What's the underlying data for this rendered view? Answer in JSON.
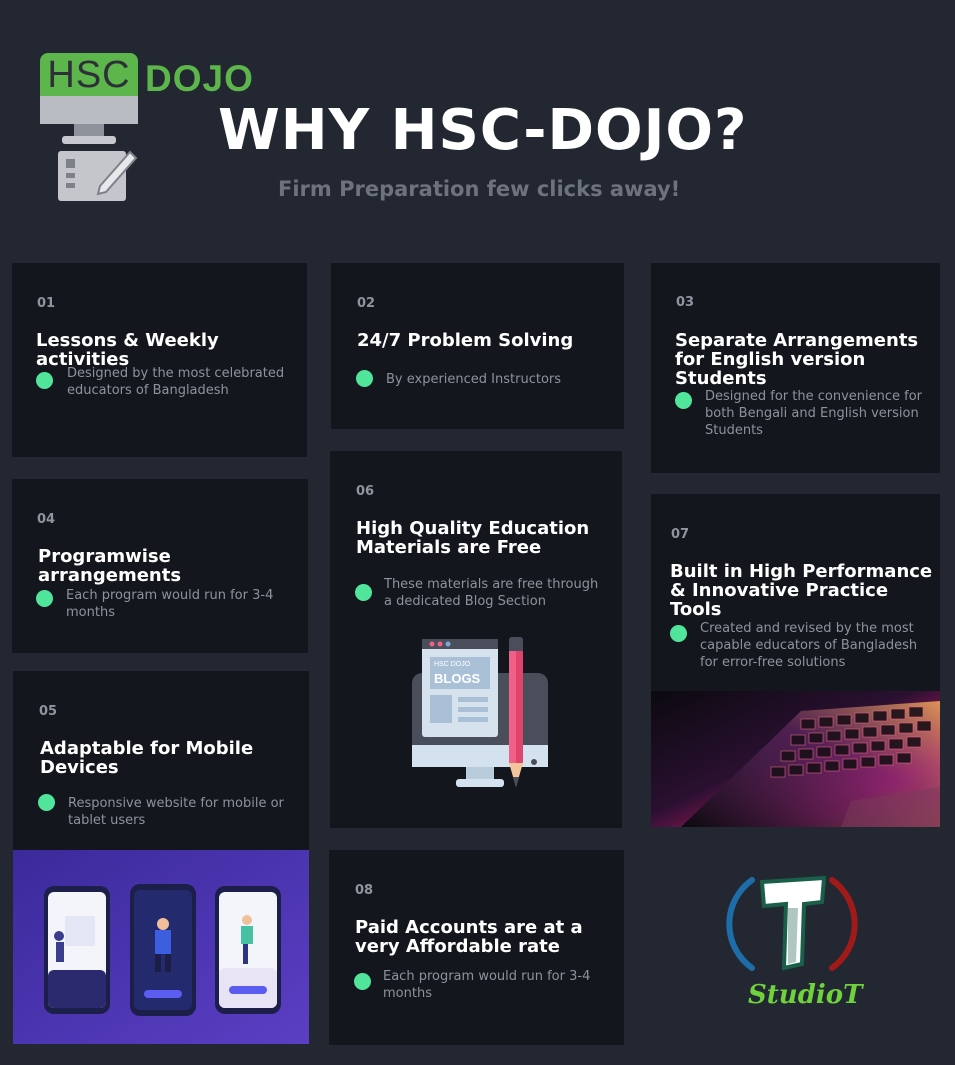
{
  "header": {
    "logo_hsc": "HSC",
    "logo_dojo": "DOJO",
    "headline": "WHY HSC-DOJO?",
    "subtitle": "Firm Preparation few clicks away!"
  },
  "colors": {
    "background": "#222731",
    "card": "#14161d",
    "bullet": "#51e59b",
    "brand_green": "#5db64b"
  },
  "cards": [
    {
      "num": "01",
      "title": "Lessons & Weekly activities",
      "desc": "Designed by the most celebrated educators of Bangladesh"
    },
    {
      "num": "02",
      "title": "24/7 Problem Solving",
      "desc": "By experienced Instructors"
    },
    {
      "num": "03",
      "title": "Separate Arrangements for English version Students",
      "desc": "Designed for the convenience for both Bengali and English version Students"
    },
    {
      "num": "04",
      "title": "Programwise arrangements",
      "desc": "Each program would run for 3-4 months"
    },
    {
      "num": "05",
      "title": "Adaptable for Mobile Devices",
      "desc": "Responsive website for mobile or tablet users"
    },
    {
      "num": "06",
      "title": "High Quality Education Materials are Free",
      "desc": "These materials are free through a dedicated Blog Section"
    },
    {
      "num": "07",
      "title": "Built in High Performance & Innovative Practice Tools",
      "desc": "Created and revised by the most capable educators of Bangladesh for error-free solutions"
    },
    {
      "num": "08",
      "title": "Paid Accounts are at a very Affordable rate",
      "desc": "Each program would run for 3-4 months"
    }
  ],
  "blog_illustration": {
    "brand": "HSC DOJO",
    "label": "BLOGS"
  },
  "studio": {
    "name": "StudioT"
  },
  "icons": [
    "computer-pen-icon",
    "bullet-dot-icon",
    "blog-monitor-icon",
    "pencil-icon",
    "studio-t-logo-icon"
  ]
}
